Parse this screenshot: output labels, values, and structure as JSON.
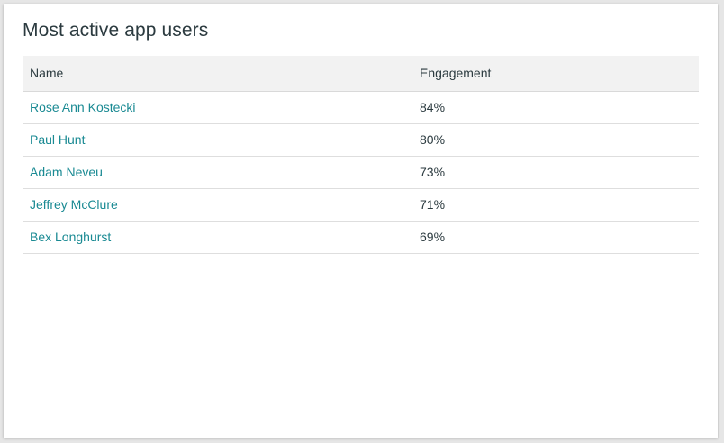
{
  "card": {
    "title": "Most active app users"
  },
  "table": {
    "headers": {
      "name": "Name",
      "engagement": "Engagement"
    },
    "rows": [
      {
        "name": "Rose Ann Kostecki",
        "engagement": "84%"
      },
      {
        "name": "Paul Hunt",
        "engagement": "80%"
      },
      {
        "name": "Adam Neveu",
        "engagement": "73%"
      },
      {
        "name": "Jeffrey McClure",
        "engagement": "71%"
      },
      {
        "name": "Bex Longhurst",
        "engagement": "69%"
      }
    ]
  },
  "colors": {
    "link": "#1a8a93",
    "text": "#2b3a3f",
    "header_bg": "#f2f2f2"
  }
}
